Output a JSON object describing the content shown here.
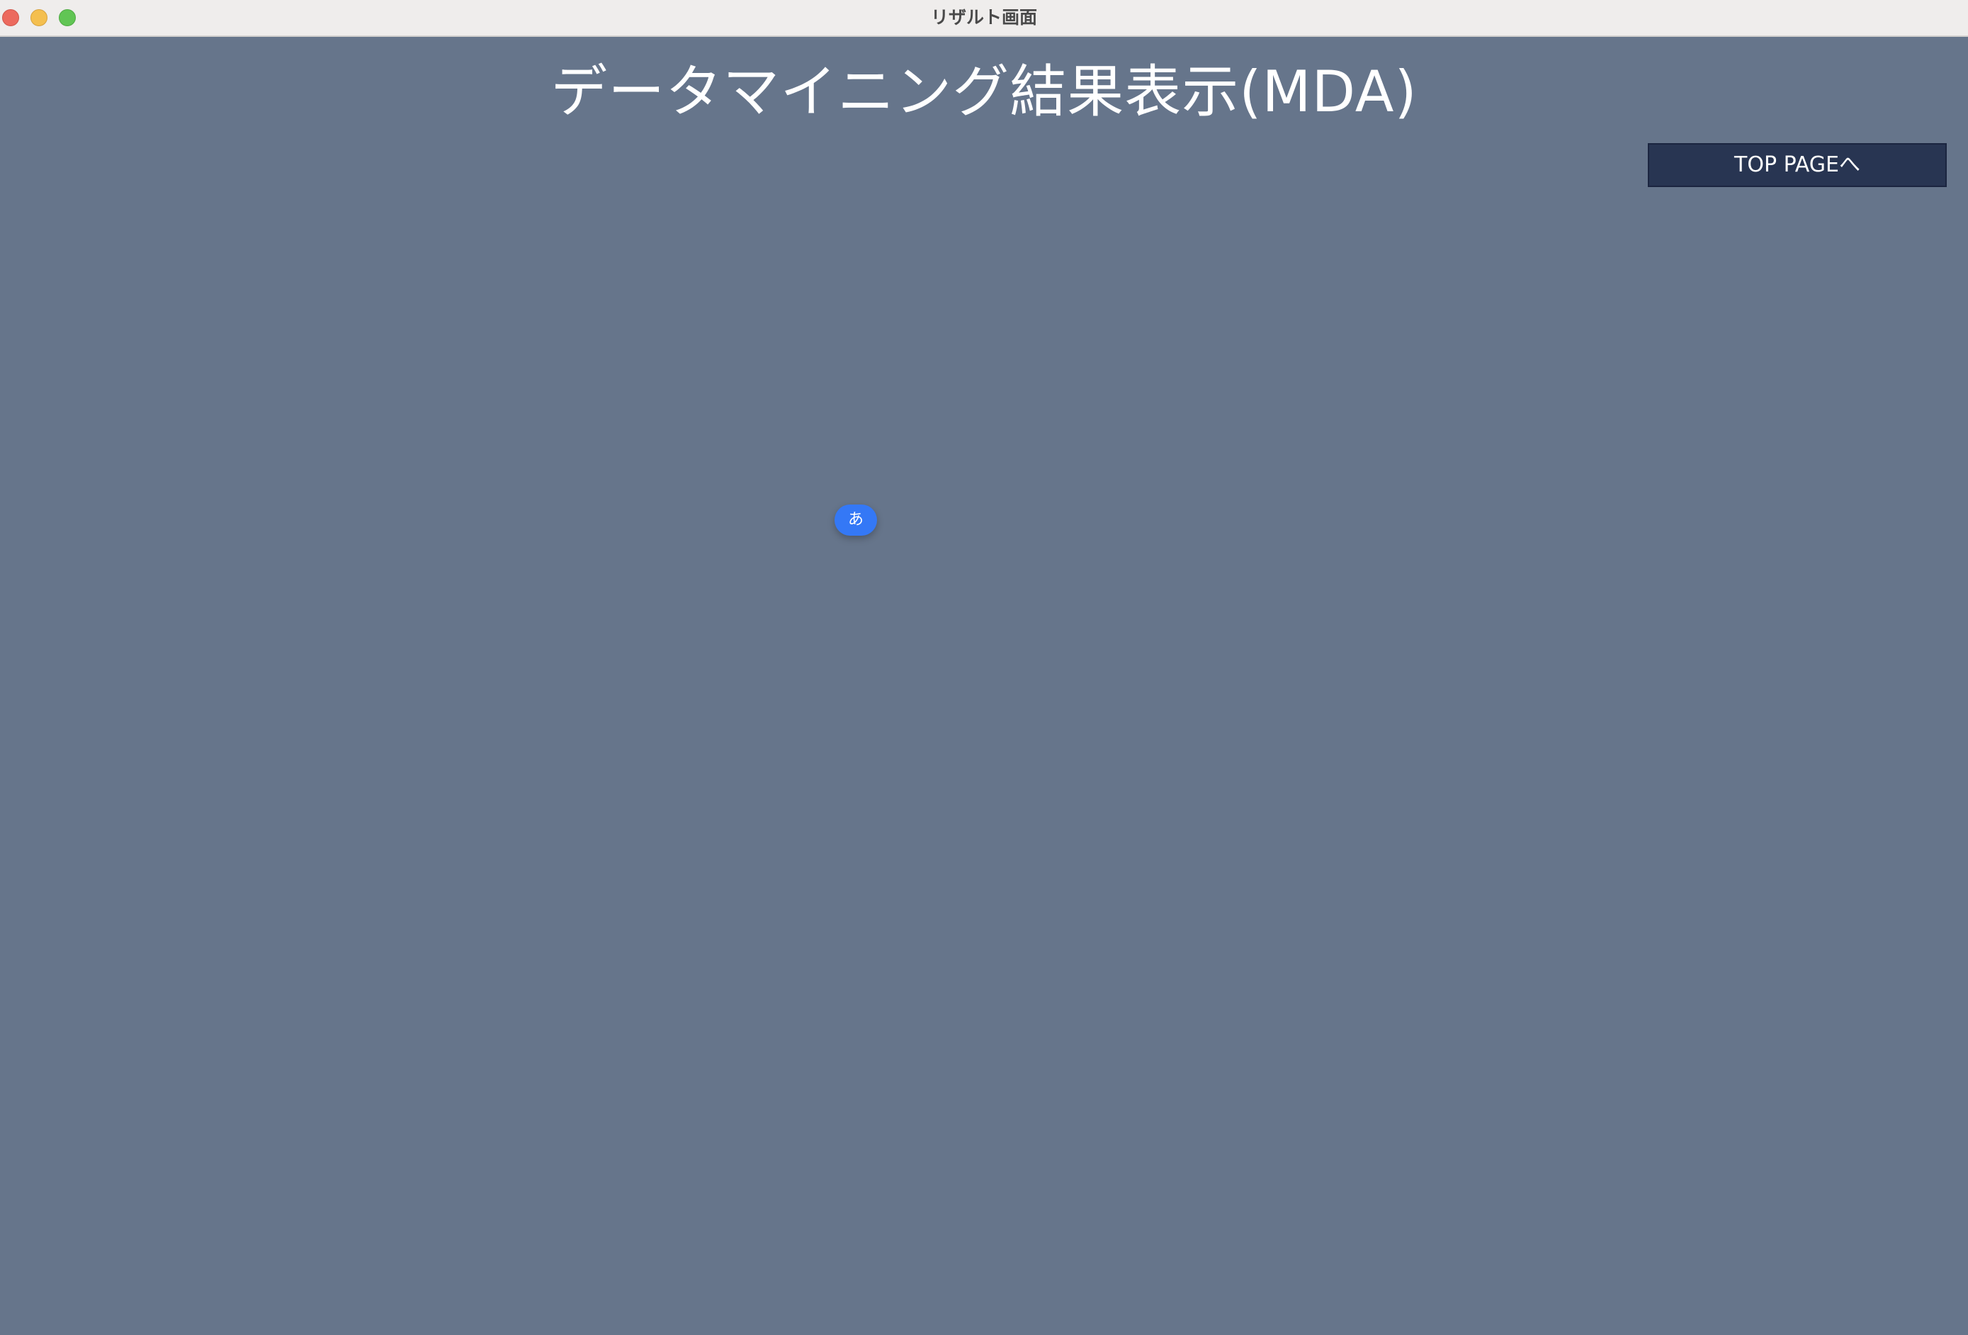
{
  "window": {
    "title": "リザルト画面"
  },
  "page": {
    "heading": "データマイニング結果表示(MDA)"
  },
  "actions": {
    "top_page_label": "TOP PAGEへ"
  },
  "ime": {
    "indicator": "あ"
  },
  "colors": {
    "background": "#66758b",
    "titlebar": "#efedec",
    "button": "#283552",
    "ime_badge": "#3478f6",
    "traffic_close": "#ec6a5e",
    "traffic_minimize": "#f4bf4f",
    "traffic_zoom": "#61c554"
  }
}
